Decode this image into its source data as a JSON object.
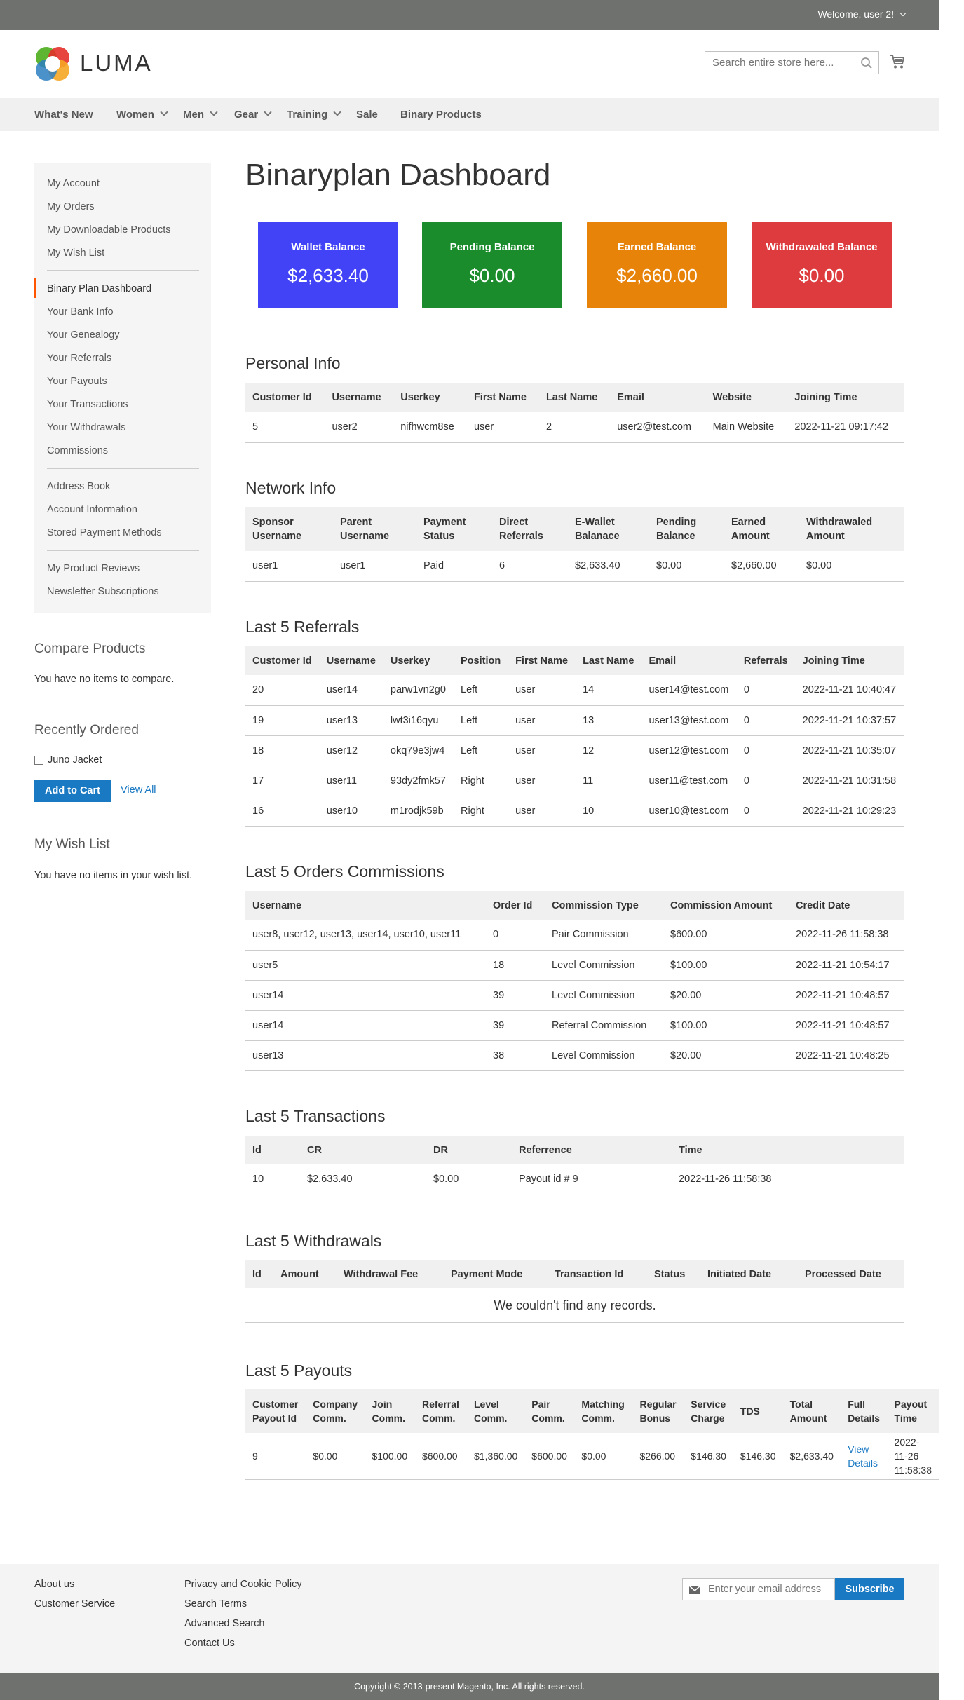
{
  "header": {
    "welcome": "Welcome, user 2!",
    "logo_text": "LUMA",
    "search_placeholder": "Search entire store here..."
  },
  "nav": {
    "items": [
      {
        "label": "What's New",
        "dropdown": false
      },
      {
        "label": "Women",
        "dropdown": true
      },
      {
        "label": "Men",
        "dropdown": true
      },
      {
        "label": "Gear",
        "dropdown": true
      },
      {
        "label": "Training",
        "dropdown": true
      },
      {
        "label": "Sale",
        "dropdown": false
      },
      {
        "label": "Binary Products",
        "dropdown": false
      }
    ]
  },
  "sidebar": {
    "items": [
      "My Account",
      "My Orders",
      "My Downloadable Products",
      "My Wish List",
      "Binary Plan Dashboard",
      "Your Bank Info",
      "Your Genealogy",
      "Your Referrals",
      "Your Payouts",
      "Your Transactions",
      "Your Withdrawals",
      "Commissions",
      "Address Book",
      "Account Information",
      "Stored Payment Methods",
      "My Product Reviews",
      "Newsletter Subscriptions"
    ],
    "active_color": "#ff5501"
  },
  "compare": {
    "title": "Compare Products",
    "text": "You have no items to compare."
  },
  "recently_ordered": {
    "title": "Recently Ordered",
    "item": "Juno Jacket",
    "add_to_cart": "Add to Cart",
    "view_all": "View All"
  },
  "wishlist": {
    "title": "My Wish List",
    "text": "You have no items in your wish list."
  },
  "page_title": "Binaryplan Dashboard",
  "cards": [
    {
      "label": "Wallet Balance",
      "value": "$2,633.40",
      "color": "#4242f6"
    },
    {
      "label": "Pending Balance",
      "value": "$0.00",
      "color": "#1a8c2c"
    },
    {
      "label": "Earned Balance",
      "value": "$2,660.00",
      "color": "#e8830a"
    },
    {
      "label": "Withdrawaled Balance",
      "value": "$0.00",
      "color": "#de3b3e"
    }
  ],
  "personal": {
    "title": "Personal Info",
    "headers": [
      "Customer Id",
      "Username",
      "Userkey",
      "First Name",
      "Last Name",
      "Email",
      "Website",
      "Joining Time"
    ],
    "row": [
      "5",
      "user2",
      "nifhwcm8se",
      "user",
      "2",
      "user2@test.com",
      "Main Website",
      "2022-11-21 09:17:42"
    ]
  },
  "network": {
    "title": "Network Info",
    "headers": [
      "Sponsor Username",
      "Parent Username",
      "Payment Status",
      "Direct Referrals",
      "E-Wallet Balanace",
      "Pending Balance",
      "Earned Amount",
      "Withdrawaled Amount"
    ],
    "row": [
      "user1",
      "user1",
      "Paid",
      "6",
      "$2,633.40",
      "$0.00",
      "$2,660.00",
      "$0.00"
    ]
  },
  "referrals": {
    "title": "Last 5 Referrals",
    "headers": [
      "Customer Id",
      "Username",
      "Userkey",
      "Position",
      "First Name",
      "Last Name",
      "Email",
      "Referrals",
      "Joining Time"
    ],
    "rows": [
      [
        "20",
        "user14",
        "parw1vn2g0",
        "Left",
        "user",
        "14",
        "user14@test.com",
        "0",
        "2022-11-21 10:40:47"
      ],
      [
        "19",
        "user13",
        "lwt3i16qyu",
        "Left",
        "user",
        "13",
        "user13@test.com",
        "0",
        "2022-11-21 10:37:57"
      ],
      [
        "18",
        "user12",
        "okq79e3jw4",
        "Left",
        "user",
        "12",
        "user12@test.com",
        "0",
        "2022-11-21 10:35:07"
      ],
      [
        "17",
        "user11",
        "93dy2fmk57",
        "Right",
        "user",
        "11",
        "user11@test.com",
        "0",
        "2022-11-21 10:31:58"
      ],
      [
        "16",
        "user10",
        "m1rodjk59b",
        "Right",
        "user",
        "10",
        "user10@test.com",
        "0",
        "2022-11-21 10:29:23"
      ]
    ]
  },
  "commissions": {
    "title": "Last 5 Orders Commissions",
    "headers": [
      "Username",
      "Order Id",
      "Commission Type",
      "Commission Amount",
      "Credit Date"
    ],
    "rows": [
      [
        "user8, user12, user13, user14, user10, user11",
        "0",
        "Pair Commission",
        "$600.00",
        "2022-11-26 11:58:38"
      ],
      [
        "user5",
        "18",
        "Level Commission",
        "$100.00",
        "2022-11-21 10:54:17"
      ],
      [
        "user14",
        "39",
        "Level Commission",
        "$20.00",
        "2022-11-21 10:48:57"
      ],
      [
        "user14",
        "39",
        "Referral Commission",
        "$100.00",
        "2022-11-21 10:48:57"
      ],
      [
        "user13",
        "38",
        "Level Commission",
        "$20.00",
        "2022-11-21 10:48:25"
      ]
    ]
  },
  "transactions": {
    "title": "Last 5 Transactions",
    "headers": [
      "Id",
      "CR",
      "DR",
      "Referrence",
      "Time"
    ],
    "rows": [
      [
        "10",
        "$2,633.40",
        "$0.00",
        "Payout id # 9",
        "2022-11-26 11:58:38"
      ]
    ]
  },
  "withdrawals": {
    "title": "Last 5 Withdrawals",
    "headers": [
      "Id",
      "Amount",
      "Withdrawal Fee",
      "Payment Mode",
      "Transaction Id",
      "Status",
      "Initiated Date",
      "Processed Date"
    ],
    "empty": "We couldn't find any records."
  },
  "payouts": {
    "title": "Last 5 Payouts",
    "headers": [
      "Customer Payout Id",
      "Company Comm.",
      "Join Comm.",
      "Referral Comm.",
      "Level Comm.",
      "Pair Comm.",
      "Matching Comm.",
      "Regular Bonus",
      "Service Charge",
      "TDS",
      "Total Amount",
      "Full Details",
      "Payout Time"
    ],
    "row": [
      "9",
      "$0.00",
      "$100.00",
      "$600.00",
      "$1,360.00",
      "$600.00",
      "$0.00",
      "$266.00",
      "$146.30",
      "$146.30",
      "$2,633.40",
      "View Details",
      "2022-11-26 11:58:38"
    ]
  },
  "footer": {
    "col1": [
      "About us",
      "Customer Service"
    ],
    "col2": [
      "Privacy and Cookie Policy",
      "Search Terms",
      "Advanced Search",
      "Contact Us"
    ],
    "newsletter_placeholder": "Enter your email address",
    "subscribe": "Subscribe",
    "copyright": "Copyright © 2013-present Magento, Inc. All rights reserved."
  }
}
